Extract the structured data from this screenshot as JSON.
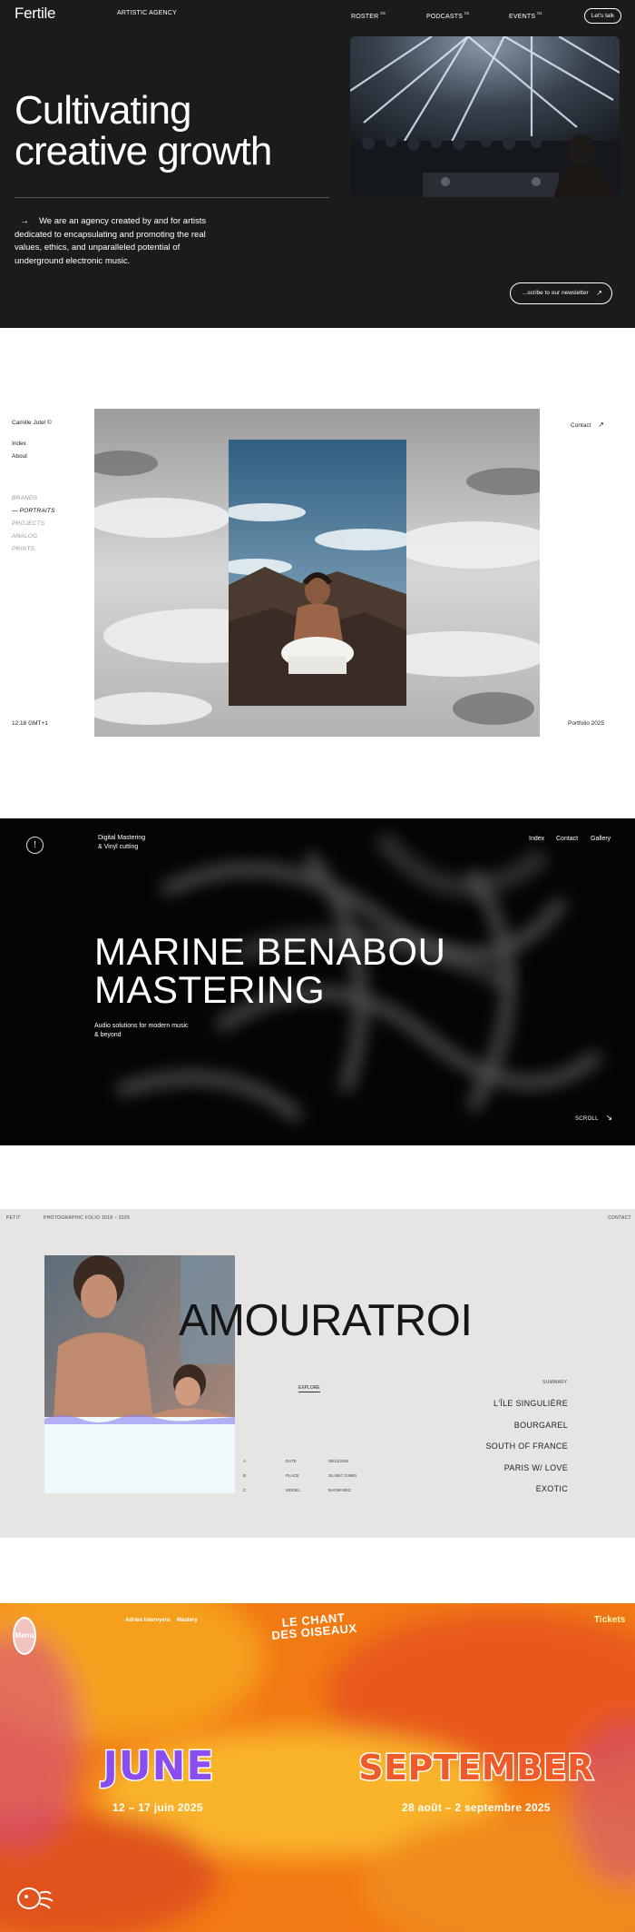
{
  "fertile": {
    "logo": "Fertile",
    "tagline": "ARTISTIC AGENCY",
    "nav": [
      {
        "label": "ROSTER",
        "count": "03"
      },
      {
        "label": "PODCASTS",
        "count": "01"
      },
      {
        "label": "EVENTS",
        "count": "01"
      }
    ],
    "cta": "Let's talk",
    "headline_line1": "Cultivating",
    "headline_line2": "creative growth",
    "arrow": "→",
    "intro": "We are an agency created by and for artists dedicated to encapsulating and promoting the real values, ethics, and unparalleled potential of underground electronic music.",
    "newsletter": "...scribe to our newsletter",
    "newsletter_arrow": "↗"
  },
  "camille": {
    "name": "Camille Jutel ©",
    "nav": [
      "Index",
      "About"
    ],
    "categories": [
      "BRANDS",
      "PORTRAITS",
      "PROJECTS",
      "ANALOG",
      "PRINTS"
    ],
    "active_category": "PORTRAITS",
    "active_marker": "—",
    "contact": "Contact",
    "contact_arrow": "↗",
    "time": "12:18 GMT+1",
    "portfolio": "Portfolio 2025"
  },
  "marine": {
    "info_icon": "!",
    "tagline_line1": "Digital Mastering",
    "tagline_line2": "& Vinyl cutting",
    "nav": [
      "Index",
      "Contact",
      "Gallery"
    ],
    "title_line1": "MARINE BENABOU",
    "title_line2": "MASTERING",
    "sub_line1": "Audio solutions for modern music",
    "sub_line2": "& beyond",
    "scroll": "SCROLL",
    "scroll_arrow": "↘"
  },
  "amour": {
    "left": "PETIT",
    "portfolio": "PHOTOGRAPHIC FOLIO 2018 – 2025",
    "contact": "CONTACT",
    "title": "AMOURATROI",
    "explore": "EXPLORE",
    "meta": [
      {
        "key": "A",
        "label": "DATE",
        "value": "05/12/2024"
      },
      {
        "key": "B",
        "label": "PLACE",
        "value": "26.4567,3.9981"
      },
      {
        "key": "C",
        "label": "MODEL",
        "value": "NAOMI BEZ"
      }
    ],
    "summary_label": "SUMMARY",
    "summary": [
      "L'ÎLE SINGULIÈRE",
      "BOURGAREL",
      "SOUTH OF FRANCE",
      "PARIS W/ LOVE",
      "EXOTIC"
    ]
  },
  "chant": {
    "menu": "Menu",
    "nav": [
      "Adrien Intervyero",
      "Mastery"
    ],
    "logo_line1": "LE CHANT",
    "logo_line2": "DES OISEAUX",
    "tickets": "Tickets",
    "june": "JUNE",
    "june_dates": "12 – 17 juin 2025",
    "september": "SEPTEMBER",
    "september_dates": "28 août – 2 septembre 2025"
  },
  "colors": {
    "fertile_bg": "#1b1b1b",
    "marine_bg": "#040404",
    "amour_bg": "#e6e5e3",
    "chant_orange": "#f27a14",
    "chant_purple": "#8b4cf0"
  }
}
